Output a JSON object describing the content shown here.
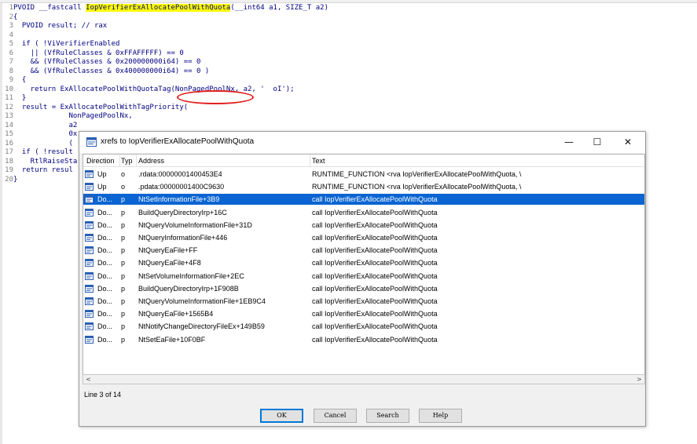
{
  "code": {
    "lines": [
      {
        "n": "1",
        "pre": "PVOID __fastcall ",
        "fn": "IopVerifierExAllocatePoolWithQuota",
        "post": "(__int64 a1, SIZE_T a2)"
      },
      {
        "n": "2",
        "text": "{"
      },
      {
        "n": "3",
        "text": "  PVOID result; // rax"
      },
      {
        "n": "4",
        "text": ""
      },
      {
        "n": "5",
        "text": "  if ( !ViVerifierEnabled"
      },
      {
        "n": "6",
        "text": "    || (VfRuleClasses & 0xFFAFFFFF) == 0"
      },
      {
        "n": "7",
        "text": "    && (VfRuleClasses & 0x200000000i64) == 0"
      },
      {
        "n": "8",
        "text": "    && (VfRuleClasses & 0x400000000i64) == 0 )"
      },
      {
        "n": "9",
        "text": "  {"
      },
      {
        "n": "10",
        "text": "    return ExAllocatePoolWithQuotaTag(NonPagedPoolNx, a2, '  oI');"
      },
      {
        "n": "11",
        "text": "  }"
      },
      {
        "n": "12",
        "text": "  result = ExAllocatePoolWithTagPriority("
      },
      {
        "n": "13",
        "text": "             NonPagedPoolNx,"
      },
      {
        "n": "14",
        "text": "             a2"
      },
      {
        "n": "15",
        "text": "             0x"
      },
      {
        "n": "16",
        "text": "             ("
      },
      {
        "n": "17",
        "text": "  if ( !result"
      },
      {
        "n": "18",
        "text": "    RtlRaiseSta"
      },
      {
        "n": "19",
        "text": "  return resul"
      },
      {
        "n": "20",
        "text": "}"
      }
    ]
  },
  "dialog": {
    "title": "xrefs to IopVerifierExAllocatePoolWithQuota",
    "minimize": "—",
    "maximize": "☐",
    "close": "✕",
    "columns": {
      "direction": "Direction",
      "type": "Typ",
      "address": "Address",
      "text": "Text"
    },
    "rows": [
      {
        "direction": "Up",
        "type": "o",
        "address": ".rdata:00000001400453E4",
        "text": "RUNTIME_FUNCTION <rva IopVerifierExAllocatePoolWithQuota, \\"
      },
      {
        "direction": "Up",
        "type": "o",
        "address": ".pdata:00000001400C9630",
        "text": "RUNTIME_FUNCTION <rva IopVerifierExAllocatePoolWithQuota, \\"
      },
      {
        "direction": "Do...",
        "type": "p",
        "address": "NtSetInformationFile+3B9",
        "text": "call    IopVerifierExAllocatePoolWithQuota"
      },
      {
        "direction": "Do...",
        "type": "p",
        "address": "BuildQueryDirectoryIrp+16C",
        "text": "call    IopVerifierExAllocatePoolWithQuota"
      },
      {
        "direction": "Do...",
        "type": "p",
        "address": "NtQueryVolumeInformationFile+31D",
        "text": "call    IopVerifierExAllocatePoolWithQuota"
      },
      {
        "direction": "Do...",
        "type": "p",
        "address": "NtQueryInformationFile+446",
        "text": "call    IopVerifierExAllocatePoolWithQuota"
      },
      {
        "direction": "Do...",
        "type": "p",
        "address": "NtQueryEaFile+FF",
        "text": "call    IopVerifierExAllocatePoolWithQuota"
      },
      {
        "direction": "Do...",
        "type": "p",
        "address": "NtQueryEaFile+4F8",
        "text": "call    IopVerifierExAllocatePoolWithQuota"
      },
      {
        "direction": "Do...",
        "type": "p",
        "address": "NtSetVolumeInformationFile+2EC",
        "text": "call    IopVerifierExAllocatePoolWithQuota"
      },
      {
        "direction": "Do...",
        "type": "p",
        "address": "BuildQueryDirectoryIrp+1F908B",
        "text": "call    IopVerifierExAllocatePoolWithQuota"
      },
      {
        "direction": "Do...",
        "type": "p",
        "address": "NtQueryVolumeInformationFile+1EB9C4",
        "text": "call    IopVerifierExAllocatePoolWithQuota"
      },
      {
        "direction": "Do...",
        "type": "p",
        "address": "NtQueryEaFile+1565B4",
        "text": "call    IopVerifierExAllocatePoolWithQuota"
      },
      {
        "direction": "Do...",
        "type": "p",
        "address": "NtNotifyChangeDirectoryFileEx+149B59",
        "text": "call    IopVerifierExAllocatePoolWithQuota"
      },
      {
        "direction": "Do...",
        "type": "p",
        "address": "NtSetEaFile+10F0BF",
        "text": "call    IopVerifierExAllocatePoolWithQuota"
      }
    ],
    "selected_row": 2,
    "scroll_left": "<",
    "scroll_right": ">",
    "status": "Line 3 of 14",
    "buttons": {
      "ok": "OK",
      "cancel": "Cancel",
      "search": "Search",
      "help": "Help"
    }
  },
  "colors": {
    "selection": "#0a64d2",
    "highlight": "#ffff00",
    "annotation_oval": "#e02020"
  }
}
